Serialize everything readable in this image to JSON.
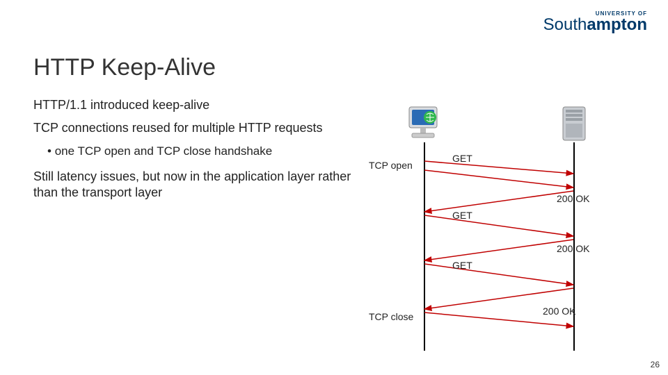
{
  "logo": {
    "upper": "UNIVERSITY OF",
    "name_prefix": "South",
    "name_bold": "ampton"
  },
  "title": "HTTP Keep-Alive",
  "para1": "HTTP/1.1 introduced keep-alive",
  "para2": "TCP connections reused for multiple HTTP requests",
  "bullet1": "one TCP open and TCP close handshake",
  "para3": "Still latency issues, but now in the application layer rather than the transport layer",
  "diagram": {
    "tcp_open": "TCP open",
    "tcp_close": "TCP close",
    "get": "GET",
    "ok": "200 OK"
  },
  "page_number": "26"
}
